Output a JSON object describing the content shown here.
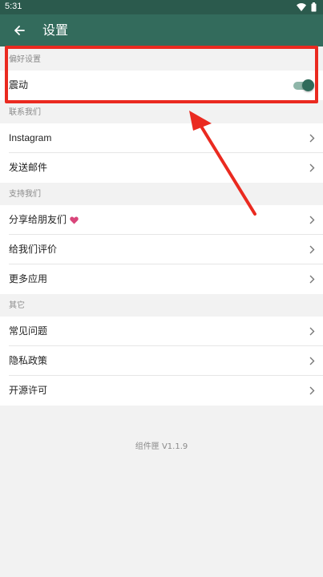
{
  "status_bar": {
    "time": "5:31"
  },
  "app_bar": {
    "title": "设置"
  },
  "sections": [
    {
      "title": "偏好设置",
      "items": [
        {
          "label": "震动",
          "type": "toggle",
          "on": true
        }
      ]
    },
    {
      "title": "联系我们",
      "items": [
        {
          "label": "Instagram"
        },
        {
          "label": "发送邮件"
        }
      ]
    },
    {
      "title": "支持我们",
      "items": [
        {
          "label": "分享给朋友们"
        },
        {
          "label": "给我们评价"
        },
        {
          "label": "更多应用"
        }
      ]
    },
    {
      "title": "其它",
      "items": [
        {
          "label": "常见问题"
        },
        {
          "label": "隐私政策"
        },
        {
          "label": "开源许可"
        }
      ]
    }
  ],
  "version": "组件匣 V1.1.9",
  "colors": {
    "primary": "#336b5c",
    "status_bar": "#2b5a4d",
    "annotation": "#ea2a20",
    "heart": "#d9457a"
  }
}
